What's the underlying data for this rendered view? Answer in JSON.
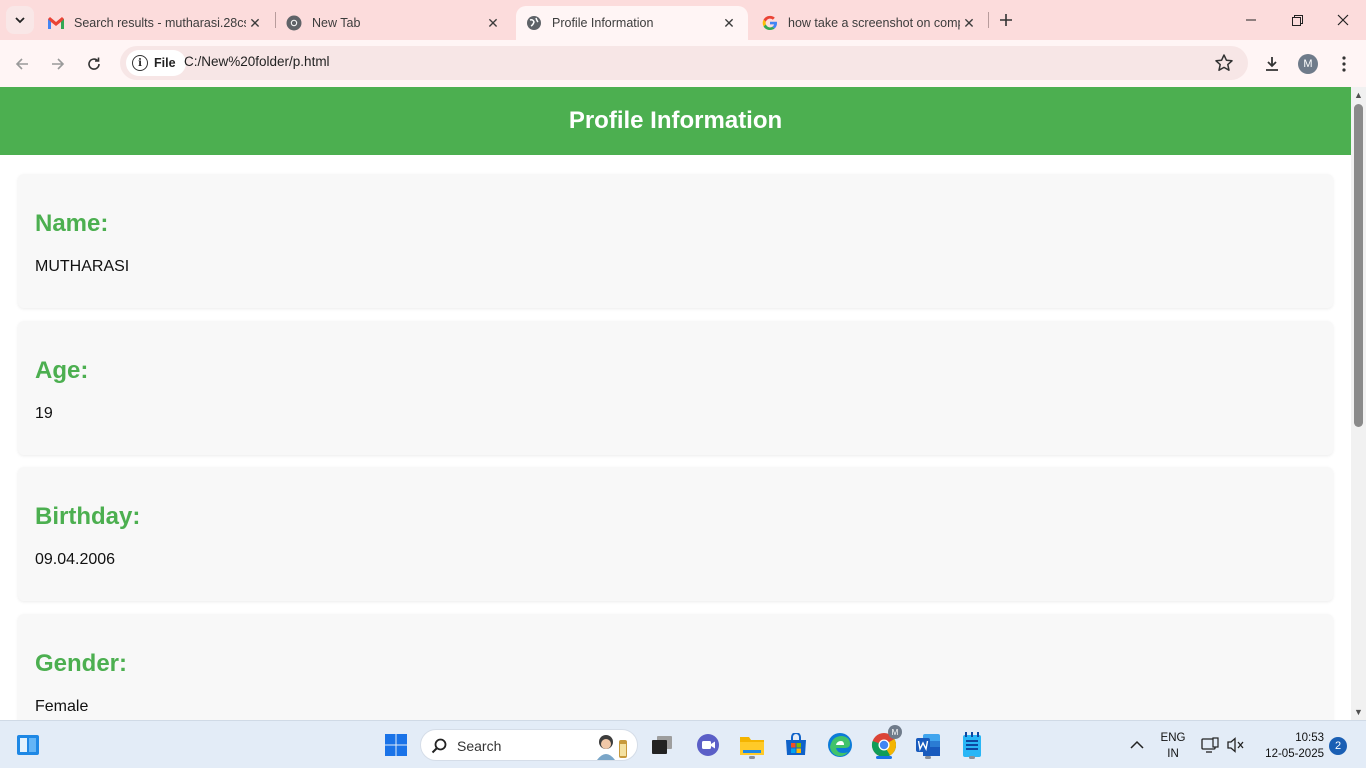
{
  "browser": {
    "tabs": [
      {
        "title": "Search results - mutharasi.28cs",
        "icon": "gmail-icon"
      },
      {
        "title": "New Tab",
        "icon": "chrome-icon"
      },
      {
        "title": "Profile Information",
        "icon": "globe-icon",
        "active": true
      },
      {
        "title": "how take a screenshot on comp",
        "icon": "google-icon"
      }
    ],
    "address": {
      "chip_label": "File",
      "url": "C:/New%20folder/p.html"
    },
    "profile_initial": "M"
  },
  "page": {
    "header_title": "Profile Information",
    "header_color": "#4caf50",
    "fields": [
      {
        "label": "Name:",
        "value": "MUTHARASI"
      },
      {
        "label": "Age:",
        "value": "19"
      },
      {
        "label": "Birthday:",
        "value": "09.04.2006"
      },
      {
        "label": "Gender:",
        "value": "Female"
      }
    ]
  },
  "taskbar": {
    "search_placeholder": "Search",
    "language": {
      "line1": "ENG",
      "line2": "IN"
    },
    "time": "10:53",
    "date": "12-05-2025",
    "notification_count": "2",
    "chrome_badge": "M"
  }
}
